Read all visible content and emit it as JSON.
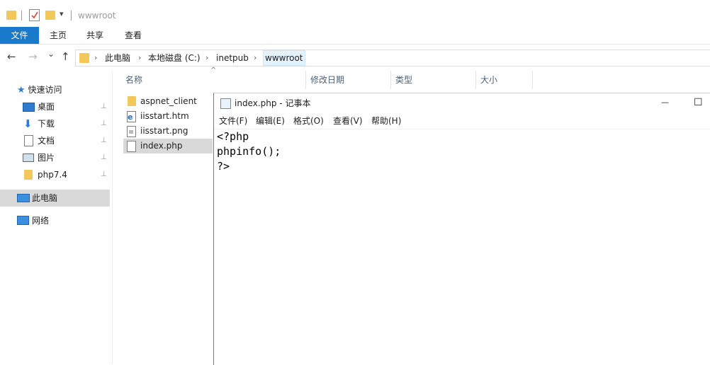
{
  "titlebar": {
    "title": "wwwroot",
    "quick_access_dropdown": "▾"
  },
  "ribbon": {
    "file": "文件",
    "home": "主页",
    "share": "共享",
    "view": "查看"
  },
  "nav": {
    "back": "←",
    "forward": "→",
    "recent": "⌄",
    "up": "↑"
  },
  "address": {
    "crumbs": [
      "此电脑",
      "本地磁盘 (C:)",
      "inetpub",
      "wwwroot"
    ],
    "separator": "›"
  },
  "navpane": {
    "quick_access": "快速访问",
    "items": [
      {
        "label": "桌面",
        "icon": "desktop-icon"
      },
      {
        "label": "下载",
        "icon": "download-icon"
      },
      {
        "label": "文档",
        "icon": "document-icon"
      },
      {
        "label": "图片",
        "icon": "picture-icon"
      },
      {
        "label": "php7.4",
        "icon": "folder-icon"
      }
    ],
    "this_pc": "此电脑",
    "network": "网络",
    "pin_glyph": "📌"
  },
  "columns": {
    "name": "名称",
    "modified": "修改日期",
    "type": "类型",
    "size": "大小",
    "sort_indicator": "^"
  },
  "files": [
    {
      "name": "aspnet_client",
      "icon": "folder-icon"
    },
    {
      "name": "iisstart.htm",
      "icon": "html-file-icon"
    },
    {
      "name": "iisstart.png",
      "icon": "image-file-icon"
    },
    {
      "name": "index.php",
      "icon": "php-file-icon"
    }
  ],
  "notepad": {
    "title": "index.php - 记事本",
    "menu": [
      "文件(F)",
      "编辑(E)",
      "格式(O)",
      "查看(V)",
      "帮助(H)"
    ],
    "minimize": "—",
    "maximize": "☐",
    "content": "<?php\nphpinfo();\n?>"
  },
  "colors": {
    "accent": "#1979ca",
    "selection": "#d9d9d9",
    "folder": "#f2c85b"
  }
}
